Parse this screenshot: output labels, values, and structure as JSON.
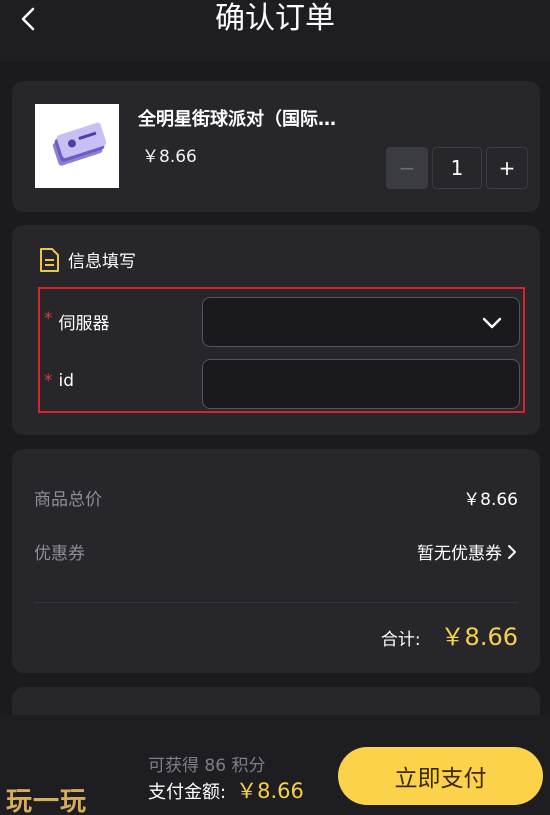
{
  "header": {
    "title": "确认订单",
    "back_icon": "chevron-left-icon"
  },
  "product": {
    "name": "全明星街球派对（国际…",
    "price": "￥8.66",
    "quantity": "1",
    "minus_label": "−",
    "plus_label": "+",
    "thumbnail_icon": "ticket-icon"
  },
  "info": {
    "title": "信息填写",
    "title_icon": "document-icon",
    "fields": [
      {
        "label": "伺服器",
        "required": "*",
        "value": "",
        "type": "select"
      },
      {
        "label": "id",
        "required": "*",
        "value": "",
        "type": "text"
      }
    ]
  },
  "summary": {
    "subtotal_label": "商品总价",
    "subtotal_value": "￥8.66",
    "coupon_label": "优惠券",
    "coupon_value": "暂无优惠券",
    "total_label": "合计:",
    "total_value": "￥8.66"
  },
  "bottom": {
    "points": "可获得 86 积分",
    "pay_label": "支付金额:",
    "pay_value": "￥8.66",
    "pay_button": "立即支付",
    "watermark": "玩一玩"
  },
  "colors": {
    "accent": "#fcd24a",
    "price": "#f4d14b",
    "required": "#e03a3a",
    "highlight_box": "#d8232a",
    "background": "#1b1b1f",
    "card": "#26262b"
  }
}
